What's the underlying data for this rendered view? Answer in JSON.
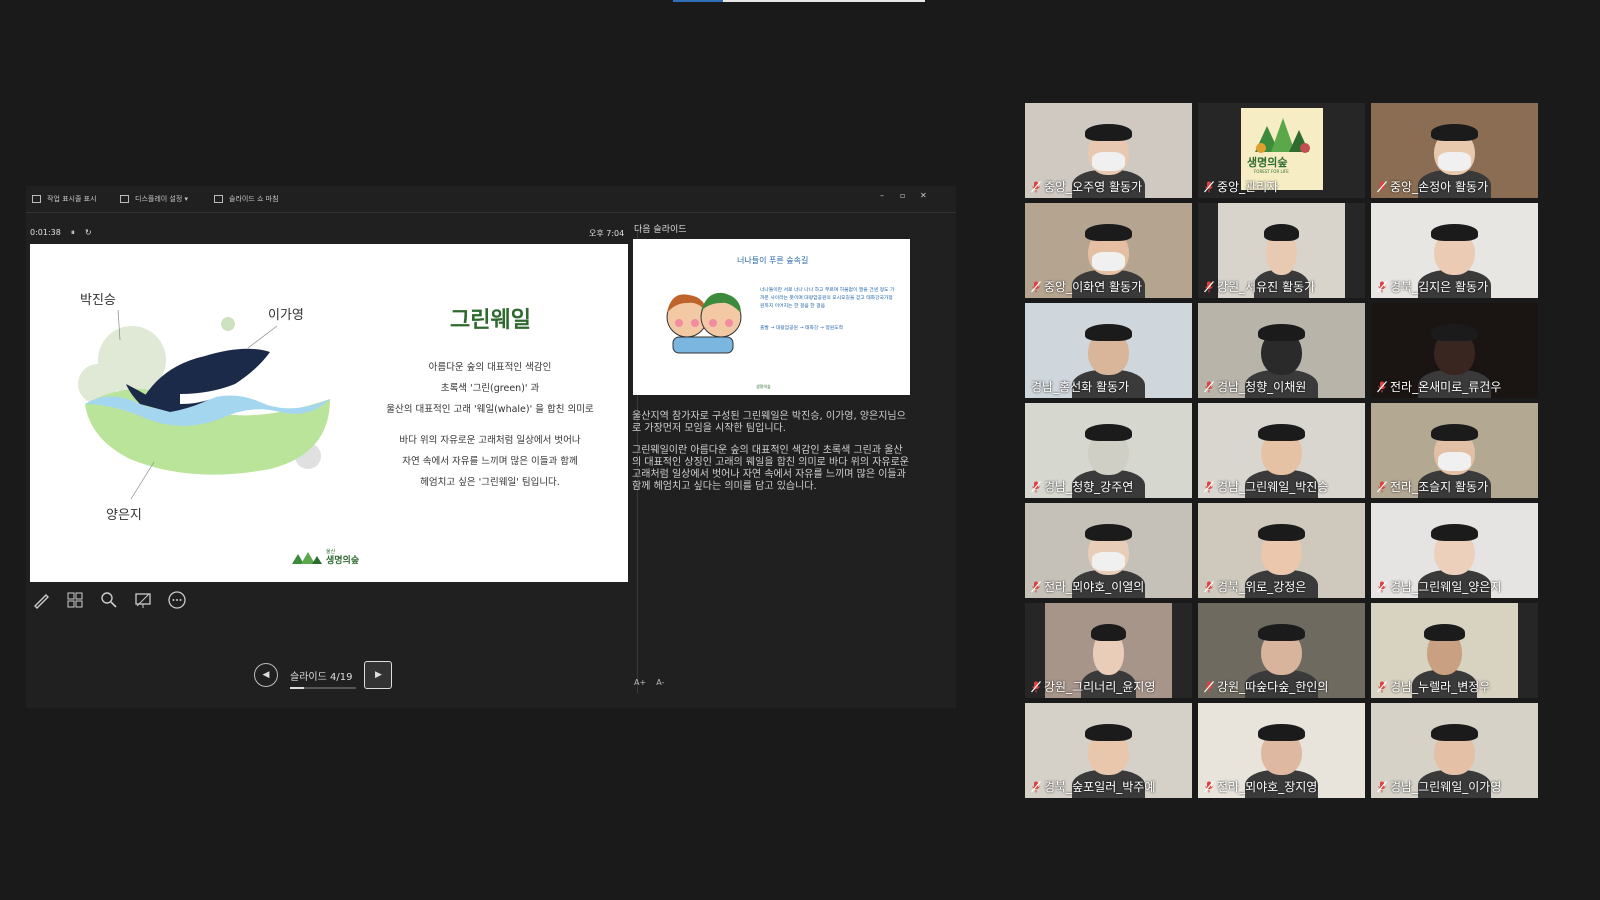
{
  "presenter": {
    "toolbar": {
      "taskbar_label": "작업 표시줄 표시",
      "display_label": "디스플레이 설정 ▾",
      "end_show_label": "슬라이드 쇼 마침"
    },
    "window_controls": [
      "–",
      "▫",
      "✕"
    ],
    "timer": "0:01:38",
    "pause": "⏸",
    "reset": "↻",
    "clock": "오후 7:04",
    "slide": {
      "title": "그린웨일",
      "names": [
        "박진승",
        "이가영",
        "양은지"
      ],
      "body_lines": [
        "아름다운 숲의 대표적인 색감인",
        "초록색 '그린(green)' 과",
        "울산의 대표적인 고래 '웨일(whale)' 을 합친 의미로",
        "",
        "바다 위의 자유로운 고래처럼 일상에서 벗어나",
        "자연 속에서 자유를 느끼며 많은 이들과 함께",
        "헤엄치고 싶은 '그린웨일' 팀입니다."
      ],
      "logo_small": "울산",
      "logo_text": "생명의숲"
    },
    "nav": {
      "prev": "◀",
      "next": "▶",
      "label": "슬라이드 4/19",
      "progress": 0.21
    },
    "next_slide": {
      "header": "다음 슬라이드",
      "title": "너나들이 푸른 숲속길",
      "text1": "너나들이란 서로 너나 나나 하고 부르며 허물없이 말을 건넨 정도 가까운 사이라는 뜻이며 대왕암공원의 오시오길을 걷고 태화강국가정원까지 이어지는 한 걸음 한 걸음",
      "text2": "출발 → 대왕암공원 → 태화강 → 정원도착",
      "foot": "생명의숲"
    },
    "notes": [
      "울산지역 참가자로 구성된 그린웨일은 박진승, 이가영, 양은지님으로 가장먼저 모임을 시작한 팀입니다.",
      "그린웨일이란 아름다운 숲의 대표적인 색감인 초록색 그린과 울산의 대표적인 상징인 고래의 웨일을 합친 의미로 바다 위의 자유로운 고래처럼 일상에서 벗어나 자연 속에서 자유를 느끼며 많은 이들과 함께 헤엄치고 싶다는 의미를 담고 있습니다."
    ],
    "font_controls": [
      "A+",
      "A-"
    ]
  },
  "gallery": {
    "management_logo": {
      "title": "생명의숲",
      "subtitle": "FOREST FOR LIFE"
    },
    "tiles": [
      {
        "label": "중앙_오주영 활동가",
        "muted": true,
        "bg": "#cfc9c2",
        "skin": "#e8c8b0",
        "mask": true
      },
      {
        "label": "중앙_관리자",
        "muted": true,
        "logo": true
      },
      {
        "label": "중앙_손정아 활동가",
        "muted": true,
        "bg": "#8a6d52",
        "skin": "#e9c9ae",
        "mask": true
      },
      {
        "label": "중앙_이화연 활동가",
        "muted": true,
        "bg": "#b5a590",
        "skin": "#e6bfa2",
        "mask": true
      },
      {
        "label": "강원_서유진 활동가",
        "muted": true,
        "bg": "#d8d4cc",
        "skin": "#e8c9b2",
        "mask": false
      },
      {
        "label": "경북_김지은 활동가",
        "muted": true,
        "bg": "#e8e6e2",
        "skin": "#eccbb5",
        "mask": false
      },
      {
        "label": "경남_홍선화 활동가",
        "muted": false,
        "bg": "#cfd6dc",
        "skin": "#d9b59a",
        "mask": false,
        "active": true
      },
      {
        "label": "경남_청향_이채원",
        "muted": true,
        "bg": "#b9b4aa",
        "skin": "#2a2a2a",
        "mask": false
      },
      {
        "label": "전라_온새미로_류건우",
        "muted": true,
        "bg": "#1a1412",
        "skin": "#3a2620",
        "mask": false
      },
      {
        "label": "경남_청향_강주연",
        "muted": true,
        "bg": "#d6d8cf",
        "skin": "#cfcfc6",
        "mask": false
      },
      {
        "label": "경남_그린웨일_박진승",
        "muted": true,
        "bg": "#d9d6d0",
        "skin": "#e6c2a5",
        "mask": false
      },
      {
        "label": "전라_조슬지 활동가",
        "muted": true,
        "bg": "#b3a892",
        "skin": "#e2c0a5",
        "mask": true
      },
      {
        "label": "전라_뫼야호_이열의",
        "muted": true,
        "bg": "#c6c1b8",
        "skin": "#e8cdb8",
        "mask": true
      },
      {
        "label": "경북_위로_강정은",
        "muted": true,
        "bg": "#cfc8bc",
        "skin": "#eac7ad",
        "mask": false
      },
      {
        "label": "경남_그린웨일_양은지",
        "muted": true,
        "bg": "#e6e4e2",
        "skin": "#ecd0bc",
        "mask": false
      },
      {
        "label": "강원_그리너리_윤지영",
        "muted": true,
        "bg": "#a8958a",
        "skin": "#e9cdb9",
        "mask": false
      },
      {
        "label": "강원_따숲다숲_한인의",
        "muted": true,
        "bg": "#6e6a60",
        "skin": "#d9b49c",
        "mask": false
      },
      {
        "label": "경남_누렐라_변정우",
        "muted": true,
        "bg": "#d8d2c0",
        "skin": "#c9a082",
        "mask": false
      },
      {
        "label": "경북_숲포일러_박주예",
        "muted": true,
        "bg": "#d5d1c8",
        "skin": "#e8c7ac",
        "mask": false
      },
      {
        "label": "전라_뫼야호_장지영",
        "muted": true,
        "bg": "#e8e4dc",
        "skin": "#deb8a0",
        "mask": false
      },
      {
        "label": "경남_그린웨일_이가영",
        "muted": true,
        "bg": "#d6d2c8",
        "skin": "#e3c0a6",
        "mask": false
      }
    ]
  }
}
